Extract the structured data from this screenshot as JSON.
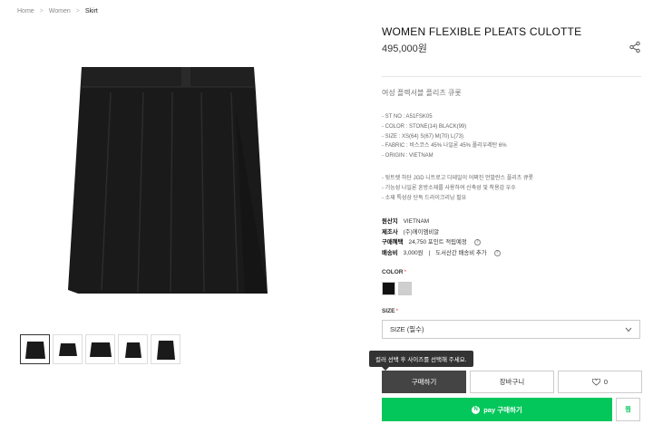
{
  "breadcrumb": {
    "items": [
      "Home",
      "Women",
      "Skirt"
    ]
  },
  "product": {
    "title": "WOMEN FLEXIBLE PLEATS CULOTTE",
    "price": "495,000원",
    "ko_name": "여성 플렉서블 플리츠 큐롯",
    "specs": [
      "- ST NO : A51FSK05",
      "- COLOR : STONE(14) BLACK(99)",
      "- SIZE : XS(64) S(67) M(70) L(73)",
      "- FABRIC : 비스코스 45% 나일론 45% 폴리우레탄 6%",
      "- ORIGIN : VIETNAM"
    ],
    "description": [
      "- 뒷트렛 하단 JGD 니트로고 디테일이 어쩌진 언발란스 플리츠 큐롯",
      "- 기능성 나일론 혼방소재를 사용하여 신축성 및 착용감 우수",
      "- 소재 특성상 단독 드라이크리닝 필요"
    ]
  },
  "meta": {
    "origin_label": "원산지",
    "origin_value": "VIETNAM",
    "maker_label": "제조사",
    "maker_value": "(주)에이엠비알",
    "points_label": "구매혜택",
    "points_value": "24,750 포인트 적립예정",
    "shipping_label": "배송비",
    "shipping_value": "3,000원",
    "shipping_note": "도서산간 배송비 추가"
  },
  "options": {
    "color_label": "COLOR",
    "color_required": "*",
    "colors": [
      "#111111",
      "#cfcfcf"
    ],
    "size_label": "SIZE",
    "size_required": "*",
    "size_placeholder": "SIZE (필수)"
  },
  "tooltip": "컬러 선택 후 사이즈를 선택해 주세요.",
  "actions": {
    "buy": "구매하기",
    "cart": "장바구니",
    "wish_count": "0",
    "npay_logo": "N",
    "npay_label": "pay 구매하기",
    "npay_wish": "찜"
  }
}
